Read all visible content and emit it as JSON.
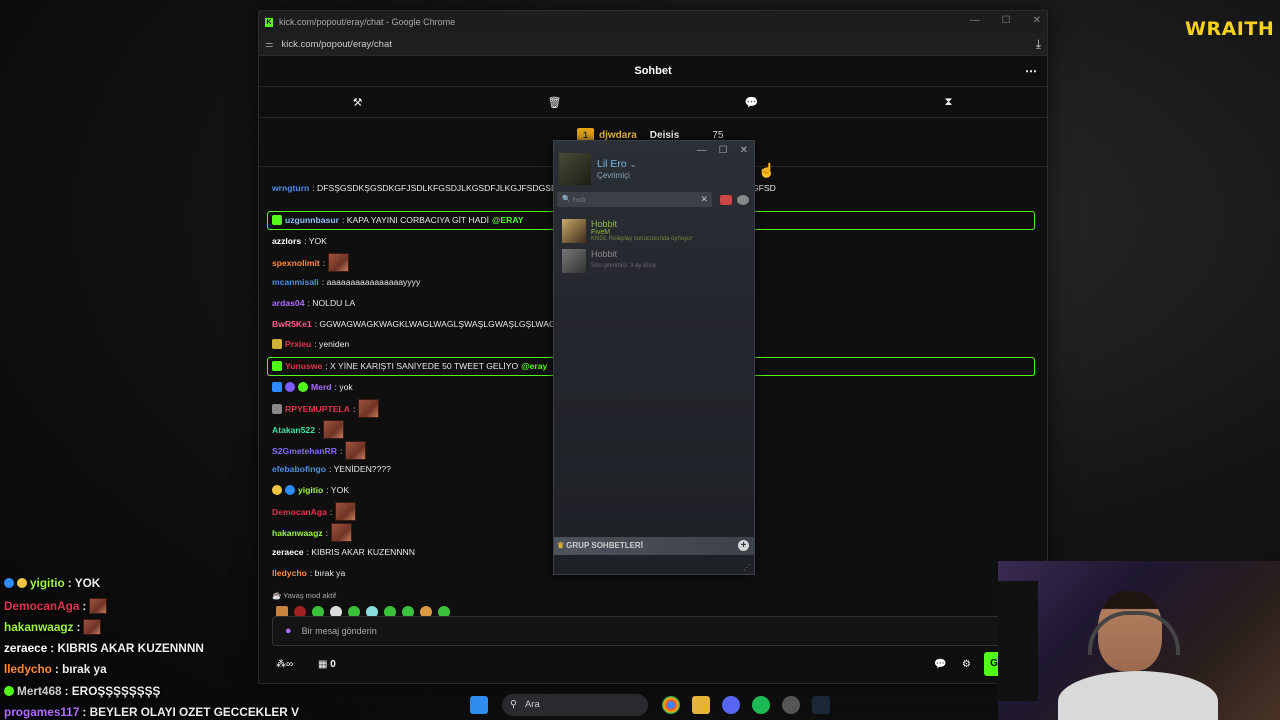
{
  "brand": "WRAITH",
  "window": {
    "title": "kick.com/popout/eray/chat - Google Chrome",
    "url": "kick.com/popout/eray/chat",
    "favicon": "K"
  },
  "chat": {
    "header": "Sohbet",
    "mod_tools": [
      "hammer-icon",
      "trash-icon",
      "chat-bubble-icon",
      "hourglass-icon"
    ],
    "pinned": {
      "leader_rank": "1",
      "leader_name": "djwdara",
      "second_name": "Deisis",
      "count": "75"
    },
    "messages": [
      {
        "user": "wrngturn",
        "text": ": DFSŞGSDKŞGSDKGFJSDLKFGSDJLKGSDFJLKGJFSDGSD",
        "text_tail": "GFSD",
        "color": "#4a90e2"
      },
      {
        "user": "uzgunnbasur",
        "text": ": KAPA YAYINI CORBACIYA GİT HADİ ",
        "mention": "@ERAY",
        "color": "#8fbfff"
      },
      {
        "user": "azzlors",
        "text": ": YOK",
        "color": "#ffffff"
      },
      {
        "user": "spexnolimit",
        "text": ":",
        "color": "#ff8a3a"
      },
      {
        "user": "mcanmisali",
        "text": ": aaaaaaaaaaaaaaaayyyy",
        "color": "#4a90e2"
      },
      {
        "user": "ardas04",
        "text": ": NOLDU LA",
        "color": "#b06cff"
      },
      {
        "user": "BwR5Ke1",
        "text": ": GGWAGWAGKWAGKLWAGLWAGLŞWAŞLGWAŞLGŞLWAG",
        "color": "#ff5c8a"
      },
      {
        "user": "Prxieu",
        "text": ": yeniden",
        "color": "#e0334b"
      },
      {
        "user": "Yunuswe",
        "text": ": X YİNE KARIŞTI SANİYEDE 50 TWEET GELİYO ",
        "mention": "@eray",
        "color": "#e0334b"
      },
      {
        "user": "Merd",
        "text": ": yok",
        "color": "#b06cff"
      },
      {
        "user": "RPYEMUPTELA",
        "text": ":",
        "color": "#e0334b"
      },
      {
        "user": "Atakan522",
        "text": ":",
        "color": "#40e0a0"
      },
      {
        "user": "S2GmetehanRR",
        "text": ":",
        "color": "#8a6cff"
      },
      {
        "user": "efebabofingo",
        "text": ": YENİDEN????",
        "color": "#4a90e2"
      },
      {
        "user": "yigitio",
        "text": ": YOK",
        "color": "#9ef542"
      },
      {
        "user": "DemocanAga",
        "text": ":",
        "color": "#e0334b"
      },
      {
        "user": "hakanwaagz",
        "text": ":",
        "color": "#9ef542"
      },
      {
        "user": "zeraece",
        "text": ": KIBRIS AKAR KUZENNNN",
        "color": "#ffffff"
      },
      {
        "user": "lledycho",
        "text": ": bırak ya",
        "color": "#ff8a3a"
      }
    ],
    "slow_mode": "Yavaş mod aktif",
    "input_placeholder": "Bir mesaj gönderin",
    "points_value": "0",
    "send_label": "G"
  },
  "steam": {
    "user_name": "Lil Ero",
    "user_status": "Çevrimiçi",
    "search_value": "hob",
    "friends": [
      {
        "name": "Hobbit",
        "game": "FiveM",
        "status": "KNGL Roleplay sunucusunda oynuyor",
        "state": "in-game"
      },
      {
        "name": "Hobbit",
        "game": "",
        "status": "Son çevrimiçi: 3 ay önce",
        "state": "offline"
      }
    ],
    "group_chats": "GRUP SOHBETLERİ"
  },
  "overlay_chat": [
    {
      "user": "yigitio",
      "text": ": YOK",
      "color": "#9ef542"
    },
    {
      "user": "DemocanAga",
      "text": ":",
      "color": "#e0334b"
    },
    {
      "user": "hakanwaagz",
      "text": ":",
      "color": "#9ef542"
    },
    {
      "user": "zeraece",
      "text": ": KIBRIS AKAR KUZENNNN",
      "color": "#ffffff"
    },
    {
      "user": "lledycho",
      "text": ": bırak ya",
      "color": "#ff8a3a"
    },
    {
      "user": "Mert468",
      "text": ": EROŞŞŞŞŞŞŞŞ",
      "color": "#cccccc"
    },
    {
      "user": "progames117",
      "text": ": BEYLER OLAYI OZET GECCEKLER V",
      "color": "#b06cff"
    }
  ],
  "taskbar": {
    "search_label": "Ara"
  }
}
